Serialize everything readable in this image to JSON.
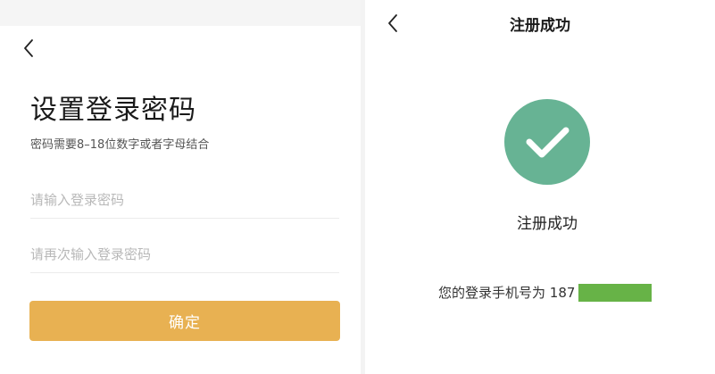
{
  "setup_password": {
    "title": "设置登录密码",
    "hint": "密码需要8–18位数字或者字母结合",
    "password_placeholder": "请输入登录密码",
    "confirm_password_placeholder": "请再次输入登录密码",
    "confirm_button": "确定"
  },
  "register_success": {
    "nav_title": "注册成功",
    "message": "注册成功",
    "phone_label": "您的登录手机号为",
    "phone_prefix": "187"
  },
  "colors": {
    "button": "#e8b152",
    "success": "#67b394",
    "phone_mask": "#67b347"
  },
  "icons": {
    "back": "chevron-left-icon",
    "success": "checkmark-icon"
  }
}
